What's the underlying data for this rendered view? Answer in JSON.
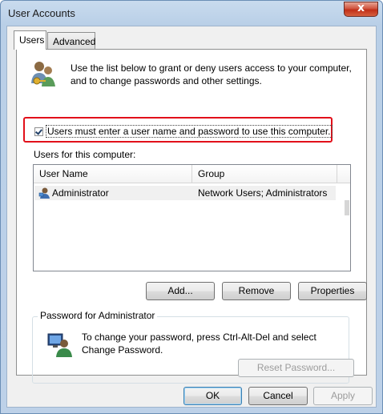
{
  "window": {
    "title": "User Accounts",
    "close_glyph": "x"
  },
  "tabs": [
    {
      "label": "Users"
    },
    {
      "label": "Advanced"
    }
  ],
  "intro_text": "Use the list below to grant or deny users access to your computer, and to change passwords and other settings.",
  "require_login": {
    "label": "Users must enter a user name and password to use this computer.",
    "checked": true
  },
  "users_label": "Users for this computer:",
  "table": {
    "columns": [
      "User Name",
      "Group"
    ],
    "rows": [
      {
        "user": "Administrator",
        "group": "Network Users; Administrators"
      }
    ]
  },
  "buttons": {
    "add": "Add...",
    "remove": "Remove",
    "properties": "Properties"
  },
  "password_group": {
    "title": "Password for Administrator",
    "text": "To change your password, press Ctrl-Alt-Del and select Change Password.",
    "reset": "Reset Password..."
  },
  "footer": {
    "ok": "OK",
    "cancel": "Cancel",
    "apply": "Apply"
  },
  "colors": {
    "highlight_border": "#e2101a",
    "title_bar": "#bdd1e8",
    "close_button": "#c02f18"
  },
  "icons": [
    "users-icon",
    "user-icon",
    "password-icon",
    "close-icon",
    "checkbox-checked-icon"
  ]
}
